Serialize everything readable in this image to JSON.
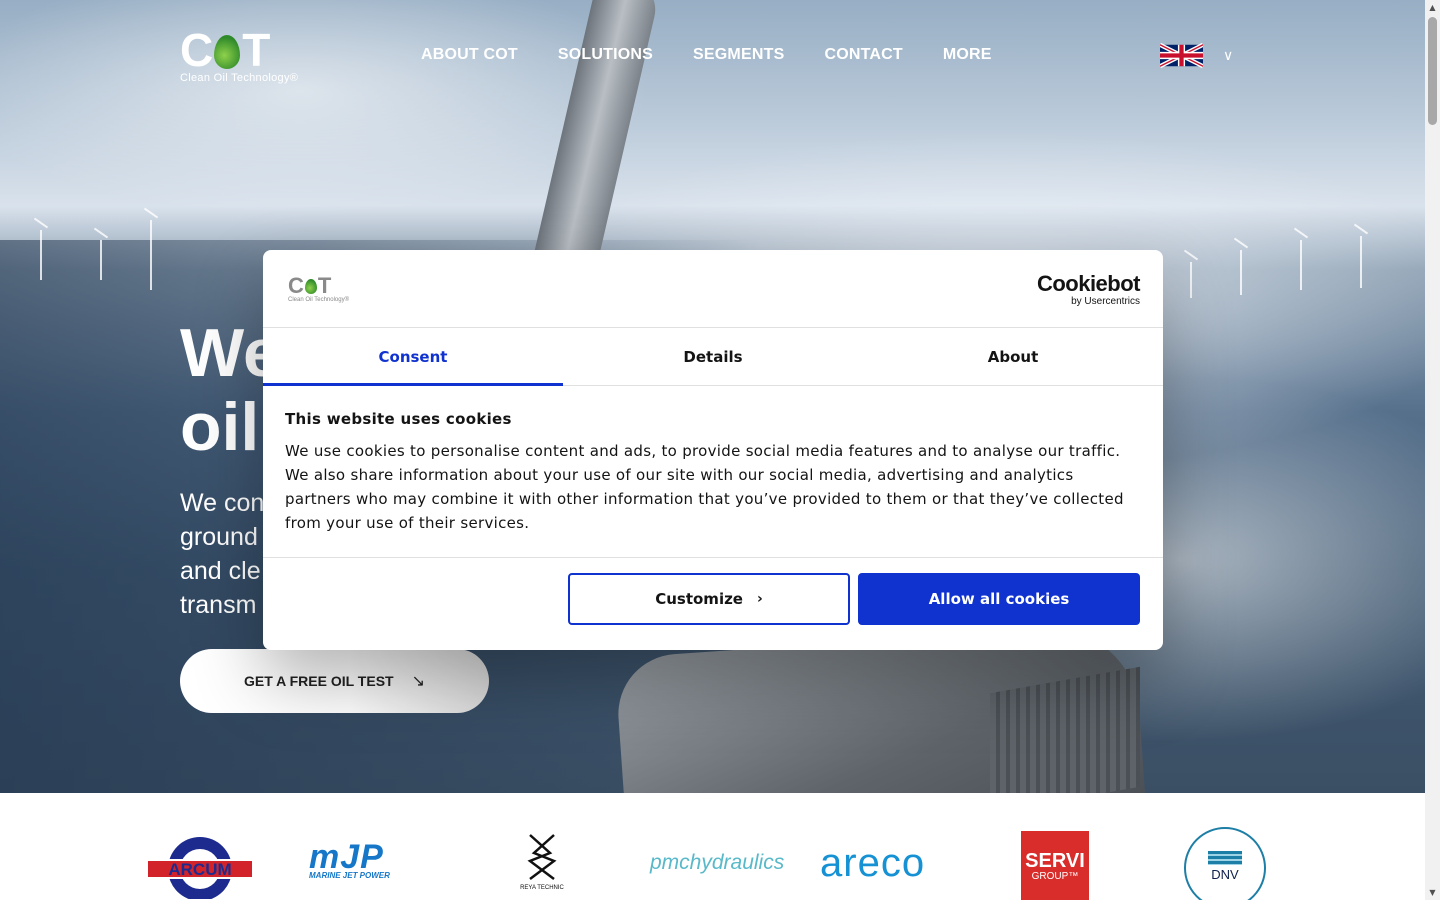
{
  "header": {
    "logo_word": "COT",
    "logo_tagline": "Clean Oil Technology®",
    "nav": [
      "ABOUT COT",
      "SOLUTIONS",
      "SEGMENTS",
      "CONTACT",
      "MORE"
    ],
    "language": "English (UK flag)"
  },
  "hero": {
    "title_line1": "We",
    "title_line2": "oil",
    "subtitle": "We con… ground… and cle… transm…",
    "subtitle_lines": [
      "We con",
      "ground",
      "and cle",
      "transm"
    ],
    "cta_label": "GET A FREE OIL TEST",
    "cta_icon": "arrow-down-right-icon"
  },
  "partners": [
    "ARCUM",
    "MJP MARINE JET POWER",
    "REYA TECHNIC",
    "pmchydraulics",
    "areco",
    "SERVI GROUP",
    "TYPE APPROVED PRODUCT DNV"
  ],
  "cookie_dialog": {
    "brand": "Cookiebot",
    "brand_sub": "by Usercentrics",
    "tabs": [
      "Consent",
      "Details",
      "About"
    ],
    "active_tab": "Consent",
    "heading": "This website uses cookies",
    "body": "We use cookies to personalise content and ads, to provide social media features and to analyse our traffic. We also share information about your use of our site with our social media, advertising and analytics partners who may combine it with other information that you’ve provided to them or that they’ve collected from your use of their services.",
    "customize_label": "Customize",
    "allow_label": "Allow all cookies",
    "accent": "#1032cf"
  }
}
